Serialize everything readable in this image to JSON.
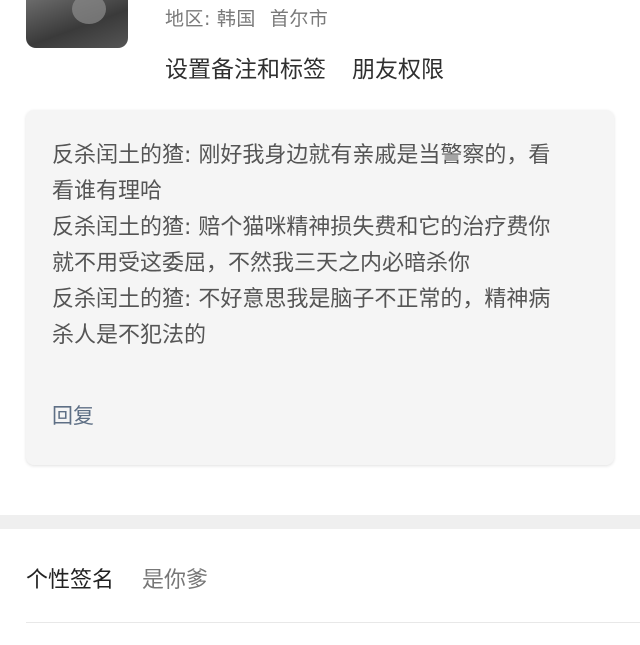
{
  "profile": {
    "region_label": "地区:",
    "region_country": "韩国",
    "region_city": "首尔市"
  },
  "actions": {
    "remark_tags": "设置备注和标签",
    "friend_permissions": "朋友权限"
  },
  "messages": [
    {
      "text": "反杀闰土的猹: 刚好我身边就有亲戚是当警察的，看看谁有理哈"
    },
    {
      "text": "反杀闰土的猹: 赔个猫咪精神损失费和它的治疗费你就不用受这委屈，不然我三天之内必暗杀你"
    },
    {
      "text": "反杀闰土的猹: 不好意思我是脑子不正常的，精神病杀人是不犯法的"
    }
  ],
  "reply_label": "回复",
  "signature": {
    "label": "个性签名",
    "value": "是你爹"
  }
}
